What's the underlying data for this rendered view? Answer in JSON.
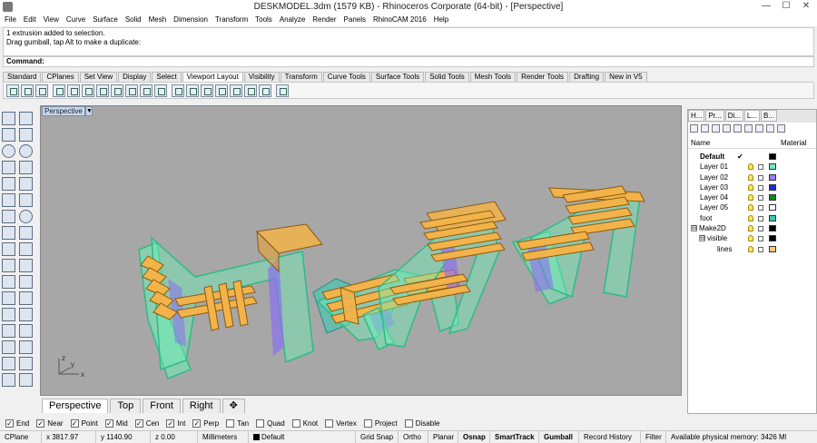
{
  "window": {
    "title": "DESKMODEL.3dm (1579 KB) - Rhinoceros Corporate (64-bit) - [Perspective]",
    "minimize": "—",
    "maximize": "☐",
    "close": "✕"
  },
  "menu": [
    "File",
    "Edit",
    "View",
    "Curve",
    "Surface",
    "Solid",
    "Mesh",
    "Dimension",
    "Transform",
    "Tools",
    "Analyze",
    "Render",
    "Panels",
    "RhinoCAM 2016",
    "Help"
  ],
  "history": [
    "1 extrusion added to selection.",
    "Drag gumball, tap Alt to make a duplicate:"
  ],
  "command": {
    "label": "Command:"
  },
  "toolbar_tabs": [
    "Standard",
    "CPlanes",
    "Set View",
    "Display",
    "Select",
    "Viewport Layout",
    "Visibility",
    "Transform",
    "Curve Tools",
    "Surface Tools",
    "Solid Tools",
    "Mesh Tools",
    "Render Tools",
    "Drafting",
    "New in V5"
  ],
  "toolbar_active_tab": "Viewport Layout",
  "viewport": {
    "title": "Perspective",
    "menu_arrow": "▼",
    "background": "#a6a6a6"
  },
  "viewport_tabs": [
    "Perspective",
    "Top",
    "Front",
    "Right"
  ],
  "viewport_add": "✥",
  "axes": {
    "x": "x",
    "y": "y",
    "z": "z"
  },
  "osnaps": [
    {
      "label": "End",
      "checked": true
    },
    {
      "label": "Near",
      "checked": true
    },
    {
      "label": "Point",
      "checked": true
    },
    {
      "label": "Mid",
      "checked": true
    },
    {
      "label": "Cen",
      "checked": true
    },
    {
      "label": "Int",
      "checked": true
    },
    {
      "label": "Perp",
      "checked": true
    },
    {
      "label": "Tan",
      "checked": false
    },
    {
      "label": "Quad",
      "checked": false
    },
    {
      "label": "Knot",
      "checked": false
    },
    {
      "label": "Vertex",
      "checked": false
    },
    {
      "label": "Project",
      "checked": false
    },
    {
      "label": "Disable",
      "checked": false
    }
  ],
  "status": {
    "cplane": "CPlane",
    "x": "x 3817.97",
    "y": "y 1140.90",
    "z": "z 0.00",
    "units": "Millimeters",
    "layer": "Default",
    "grid_snap": "Grid Snap",
    "ortho": "Ortho",
    "planar": "Planar",
    "osnap": "Osnap",
    "smarttrack": "SmartTrack",
    "gumball": "Gumball",
    "record_history": "Record History",
    "filter": "Filter",
    "memory": "Available physical memory: 3426 MB"
  },
  "panel": {
    "tabs": [
      "H...",
      "Pr...",
      "Di...",
      "L...",
      "B..."
    ],
    "active_tab": "L...",
    "header": {
      "name": "Name",
      "material": "Material"
    },
    "layers": [
      {
        "name": "Default",
        "current": true,
        "check": "✔",
        "color": "#000000"
      },
      {
        "name": "Layer 01",
        "color": "#73e6c7"
      },
      {
        "name": "Layer 02",
        "color": "#9a7df2"
      },
      {
        "name": "Layer 03",
        "color": "#1b2cd6"
      },
      {
        "name": "Layer 04",
        "color": "#0b8a1f"
      },
      {
        "name": "Layer 05",
        "color": "#ffffff"
      },
      {
        "name": "foot",
        "color": "#3cc9b0"
      },
      {
        "name": "Make2D",
        "color": "#000000",
        "tree": "⊟"
      },
      {
        "name": "visible",
        "color": "#000000",
        "tree": "⊟"
      },
      {
        "name": "lines",
        "color": "#f5c97a"
      }
    ]
  },
  "colors": {
    "mint": "#6ff0b8",
    "purple": "#8a6ff0",
    "orange": "#f2b34a"
  }
}
